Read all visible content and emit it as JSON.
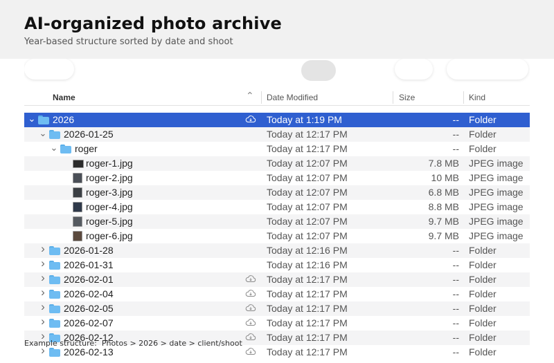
{
  "header": {
    "title": "AI-organized photo archive",
    "subtitle": "Year-based structure sorted by date and shoot"
  },
  "columns": {
    "name": "Name",
    "date": "Date Modified",
    "size": "Size",
    "kind": "Kind"
  },
  "rows": [
    {
      "name": "2026",
      "date": "Today at 1:19 PM",
      "size": "--",
      "kind": "Folder",
      "type": "folder",
      "depth": 0,
      "expanded": true,
      "selected": true,
      "cloud": true
    },
    {
      "name": "2026-01-25",
      "date": "Today at 12:17 PM",
      "size": "--",
      "kind": "Folder",
      "type": "folder",
      "depth": 1,
      "expanded": true,
      "selected": false,
      "cloud": false
    },
    {
      "name": "roger",
      "date": "Today at 12:17 PM",
      "size": "--",
      "kind": "Folder",
      "type": "folder",
      "depth": 2,
      "expanded": true,
      "selected": false,
      "cloud": false
    },
    {
      "name": "roger-1.jpg",
      "date": "Today at 12:07 PM",
      "size": "7.8 MB",
      "kind": "JPEG image",
      "type": "image",
      "depth": 3,
      "selected": false,
      "cloud": false
    },
    {
      "name": "roger-2.jpg",
      "date": "Today at 12:07 PM",
      "size": "10 MB",
      "kind": "JPEG image",
      "type": "image",
      "depth": 3,
      "selected": false,
      "cloud": false
    },
    {
      "name": "roger-3.jpg",
      "date": "Today at 12:07 PM",
      "size": "6.8 MB",
      "kind": "JPEG image",
      "type": "image",
      "depth": 3,
      "selected": false,
      "cloud": false
    },
    {
      "name": "roger-4.jpg",
      "date": "Today at 12:07 PM",
      "size": "8.8 MB",
      "kind": "JPEG image",
      "type": "image",
      "depth": 3,
      "selected": false,
      "cloud": false
    },
    {
      "name": "roger-5.jpg",
      "date": "Today at 12:07 PM",
      "size": "9.7 MB",
      "kind": "JPEG image",
      "type": "image",
      "depth": 3,
      "selected": false,
      "cloud": false
    },
    {
      "name": "roger-6.jpg",
      "date": "Today at 12:07 PM",
      "size": "9.7 MB",
      "kind": "JPEG image",
      "type": "image",
      "depth": 3,
      "selected": false,
      "cloud": false
    },
    {
      "name": "2026-01-28",
      "date": "Today at 12:16 PM",
      "size": "--",
      "kind": "Folder",
      "type": "folder",
      "depth": 1,
      "expanded": false,
      "selected": false,
      "cloud": false
    },
    {
      "name": "2026-01-31",
      "date": "Today at 12:16 PM",
      "size": "--",
      "kind": "Folder",
      "type": "folder",
      "depth": 1,
      "expanded": false,
      "selected": false,
      "cloud": false
    },
    {
      "name": "2026-02-01",
      "date": "Today at 12:17 PM",
      "size": "--",
      "kind": "Folder",
      "type": "folder",
      "depth": 1,
      "expanded": false,
      "selected": false,
      "cloud": true
    },
    {
      "name": "2026-02-04",
      "date": "Today at 12:17 PM",
      "size": "--",
      "kind": "Folder",
      "type": "folder",
      "depth": 1,
      "expanded": false,
      "selected": false,
      "cloud": true
    },
    {
      "name": "2026-02-05",
      "date": "Today at 12:17 PM",
      "size": "--",
      "kind": "Folder",
      "type": "folder",
      "depth": 1,
      "expanded": false,
      "selected": false,
      "cloud": true
    },
    {
      "name": "2026-02-07",
      "date": "Today at 12:17 PM",
      "size": "--",
      "kind": "Folder",
      "type": "folder",
      "depth": 1,
      "expanded": false,
      "selected": false,
      "cloud": true
    },
    {
      "name": "2026-02-12",
      "date": "Today at 12:17 PM",
      "size": "--",
      "kind": "Folder",
      "type": "folder",
      "depth": 1,
      "expanded": false,
      "selected": false,
      "cloud": true
    },
    {
      "name": "2026-02-13",
      "date": "Today at 12:17 PM",
      "size": "--",
      "kind": "Folder",
      "type": "folder",
      "depth": 1,
      "expanded": false,
      "selected": false,
      "cloud": true
    }
  ],
  "caption": "Example structure:  Photos > 2026 > date > client/shoot"
}
